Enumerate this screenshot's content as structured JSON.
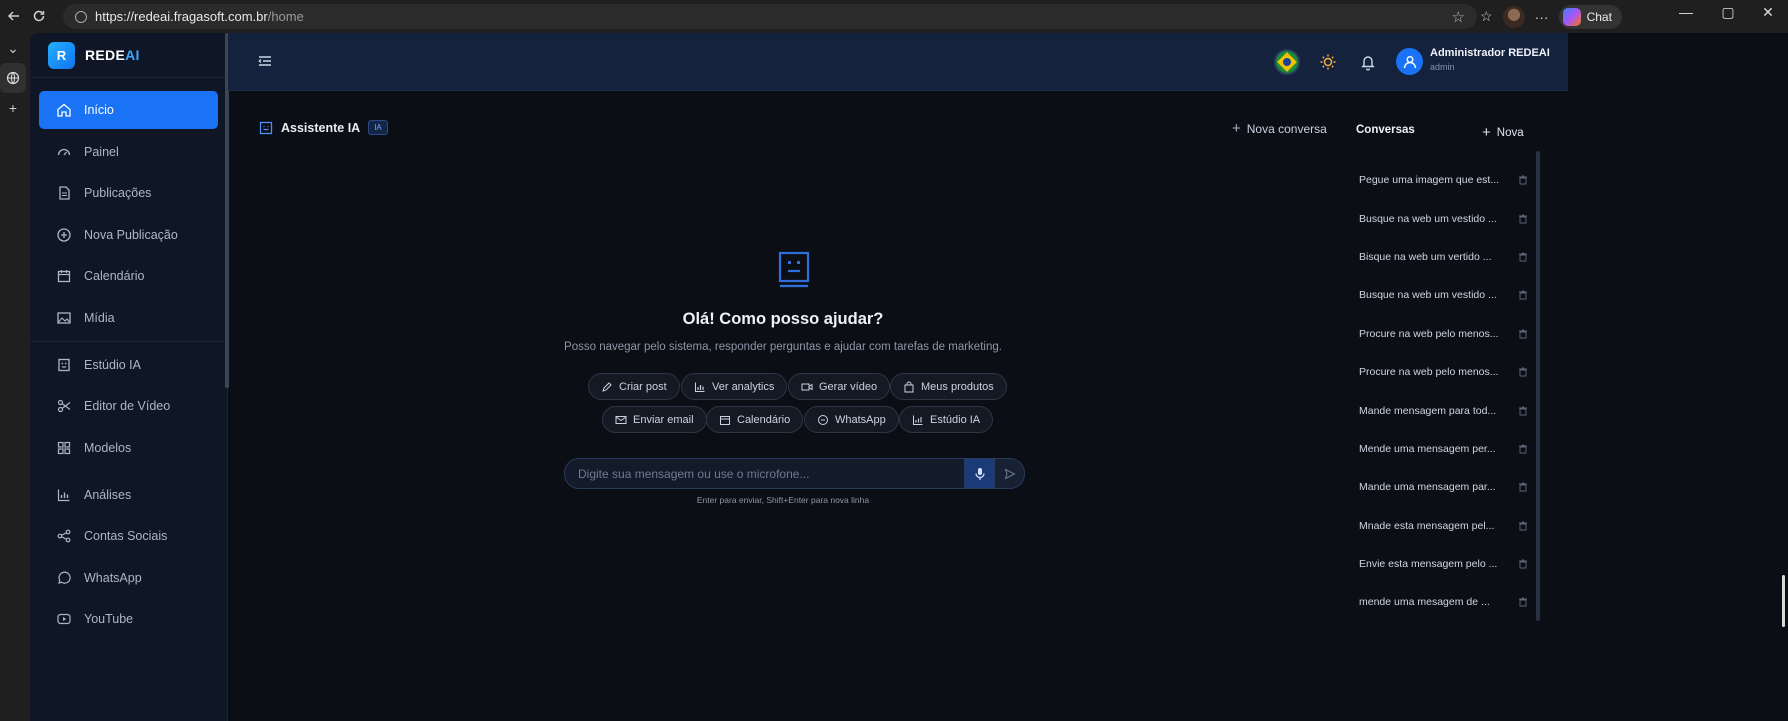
{
  "browser": {
    "url_host": "https://redeai.fragasoft.com.br",
    "url_path": "/home",
    "copilot_label": "Chat"
  },
  "sidebar": {
    "brand_initial": "R",
    "brand_name_main": "REDE",
    "brand_name_accent": "AI",
    "items": [
      {
        "label": "Início",
        "icon": "home-icon"
      },
      {
        "label": "Painel",
        "icon": "gauge-icon"
      },
      {
        "label": "Publicações",
        "icon": "document-icon"
      },
      {
        "label": "Nova Publicação",
        "icon": "plus-circle-icon"
      },
      {
        "label": "Calendário",
        "icon": "calendar-icon"
      },
      {
        "label": "Mídia",
        "icon": "image-icon"
      },
      {
        "label": "Estúdio IA",
        "icon": "robot-icon"
      },
      {
        "label": "Editor de Vídeo",
        "icon": "scissors-icon"
      },
      {
        "label": "Modelos",
        "icon": "grid-icon"
      },
      {
        "label": "Análises",
        "icon": "bar-chart-icon"
      },
      {
        "label": "Contas Sociais",
        "icon": "share-icon"
      },
      {
        "label": "WhatsApp",
        "icon": "whatsapp-icon"
      },
      {
        "label": "YouTube",
        "icon": "youtube-icon"
      }
    ]
  },
  "topbar": {
    "user_name": "Administrador REDEAI",
    "user_role": "admin"
  },
  "main": {
    "title": "Assistente IA",
    "badge": "IA",
    "new_conversation": "Nova conversa",
    "greeting": "Olá! Como posso ajudar?",
    "subtitle": "Posso navegar pelo sistema, responder perguntas e ajudar com tarefas de marketing.",
    "chips": [
      {
        "label": "Criar post",
        "icon": "pencil-icon"
      },
      {
        "label": "Ver analytics",
        "icon": "bar-chart-icon"
      },
      {
        "label": "Gerar vídeo",
        "icon": "video-icon"
      },
      {
        "label": "Meus produtos",
        "icon": "bag-icon"
      },
      {
        "label": "Enviar email",
        "icon": "mail-icon"
      },
      {
        "label": "Calendário",
        "icon": "calendar-icon"
      },
      {
        "label": "WhatsApp",
        "icon": "whatsapp-icon"
      },
      {
        "label": "Estúdio IA",
        "icon": "robot-icon"
      }
    ],
    "input_placeholder": "Digite sua mensagem ou use o microfone...",
    "hint": "Enter para enviar, Shift+Enter para nova linha"
  },
  "conversations": {
    "title": "Conversas",
    "new_label": "Nova",
    "items": [
      "Pegue uma imagem que est...",
      "Busque na web um vestido ...",
      "Bisque na web um vertido ...",
      "Busque na web um vestido ...",
      "Procure na web pelo menos...",
      "Procure na web pelo menos...",
      "Mande mensagem para tod...",
      "Mende uma mensagem per...",
      "Mande uma mensagem par...",
      "Mnade esta mensagem pel...",
      "Envie esta mensagem pelo ...",
      "mende uma mesagem de ..."
    ]
  },
  "colors": {
    "accent": "#1a73f5",
    "sidebar_bg": "#0f1626",
    "topbar_bg": "#14223e",
    "main_bg": "#0b0e14"
  }
}
